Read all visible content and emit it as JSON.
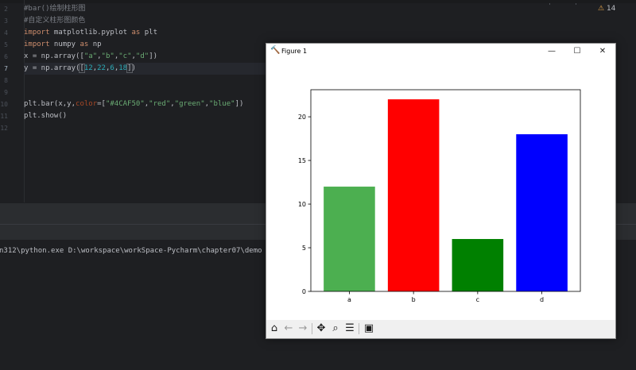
{
  "editor": {
    "line_numbers": [
      "2",
      "3",
      "4",
      "5",
      "6",
      "7",
      "8",
      "9",
      "10",
      "11",
      "12"
    ],
    "lines": [
      [
        {
          "t": "#bar()绘制柱形图",
          "c": "comment"
        }
      ],
      [
        {
          "t": "#自定义柱形图颜色",
          "c": "comment"
        }
      ],
      [
        {
          "t": "import",
          "c": "keyword"
        },
        {
          "t": " matplotlib.pyplot ",
          "c": "plain"
        },
        {
          "t": "as",
          "c": "keyword"
        },
        {
          "t": " plt",
          "c": "plain"
        }
      ],
      [
        {
          "t": "import",
          "c": "keyword"
        },
        {
          "t": " numpy ",
          "c": "plain"
        },
        {
          "t": "as",
          "c": "keyword"
        },
        {
          "t": " np",
          "c": "plain"
        }
      ],
      [
        {
          "t": "x = np.array([",
          "c": "plain"
        },
        {
          "t": "\"a\"",
          "c": "string"
        },
        {
          "t": ",",
          "c": "plain"
        },
        {
          "t": "\"b\"",
          "c": "string"
        },
        {
          "t": ",",
          "c": "plain"
        },
        {
          "t": "\"c\"",
          "c": "string"
        },
        {
          "t": ",",
          "c": "plain"
        },
        {
          "t": "\"d\"",
          "c": "string"
        },
        {
          "t": "])",
          "c": "plain"
        }
      ],
      [
        {
          "t": "y = np.array(",
          "c": "plain"
        },
        {
          "t": "[",
          "c": "plain",
          "hl": true
        },
        {
          "t": "12",
          "c": "number"
        },
        {
          "t": ",",
          "c": "plain"
        },
        {
          "t": "22",
          "c": "number"
        },
        {
          "t": ",",
          "c": "plain"
        },
        {
          "t": "6",
          "c": "number"
        },
        {
          "t": ",",
          "c": "plain"
        },
        {
          "t": "18",
          "c": "number"
        },
        {
          "t": "]",
          "c": "plain",
          "hl": true
        },
        {
          "t": ")",
          "c": "plain"
        }
      ],
      [],
      [],
      [
        {
          "t": "plt.bar(x,y,",
          "c": "plain"
        },
        {
          "t": "color",
          "c": "param"
        },
        {
          "t": "=[",
          "c": "plain"
        },
        {
          "t": "\"#4CAF50\"",
          "c": "string"
        },
        {
          "t": ",",
          "c": "plain"
        },
        {
          "t": "\"red\"",
          "c": "string"
        },
        {
          "t": ",",
          "c": "plain"
        },
        {
          "t": "\"green\"",
          "c": "string"
        },
        {
          "t": ",",
          "c": "plain"
        },
        {
          "t": "\"blue\"",
          "c": "string"
        },
        {
          "t": "])",
          "c": "plain"
        }
      ],
      [
        {
          "t": "plt.show()",
          "c": "plain"
        }
      ],
      []
    ],
    "current_line_index": 5,
    "warning_count": "14"
  },
  "console": {
    "command": "n312\\python.exe D:\\workspace\\workSpace-Pycharm\\chapter07\\demo"
  },
  "figure": {
    "window_title": "Figure 1",
    "minimize_glyph": "—",
    "maximize_glyph": "☐",
    "close_glyph": "✕",
    "toolbar": [
      {
        "name": "home-icon",
        "glyph": "⌂",
        "enabled": true
      },
      {
        "name": "back-icon",
        "glyph": "←",
        "enabled": false
      },
      {
        "name": "forward-icon",
        "glyph": "→",
        "enabled": false
      },
      {
        "name": "pan-icon",
        "glyph": "✥",
        "enabled": true
      },
      {
        "name": "zoom-icon",
        "glyph": "⌕",
        "enabled": true
      },
      {
        "name": "configure-subplots-icon",
        "glyph": "☰",
        "enabled": true
      },
      {
        "name": "save-icon",
        "glyph": "▣",
        "enabled": true
      }
    ]
  },
  "chart_data": {
    "type": "bar",
    "categories": [
      "a",
      "b",
      "c",
      "d"
    ],
    "values": [
      12,
      22,
      6,
      18
    ],
    "colors": [
      "#4CAF50",
      "#ff0000",
      "#008000",
      "#0000ff"
    ],
    "yticks": [
      0,
      5,
      10,
      15,
      20
    ],
    "ylim": [
      0,
      23.1
    ],
    "title": "",
    "xlabel": "",
    "ylabel": "",
    "grid": false,
    "legend": false
  },
  "colors": {
    "ide_background": "#1e1f22",
    "comment": "#7a7e85",
    "keyword": "#cf8e6d",
    "string": "#6aab73",
    "number": "#2aacb8"
  }
}
